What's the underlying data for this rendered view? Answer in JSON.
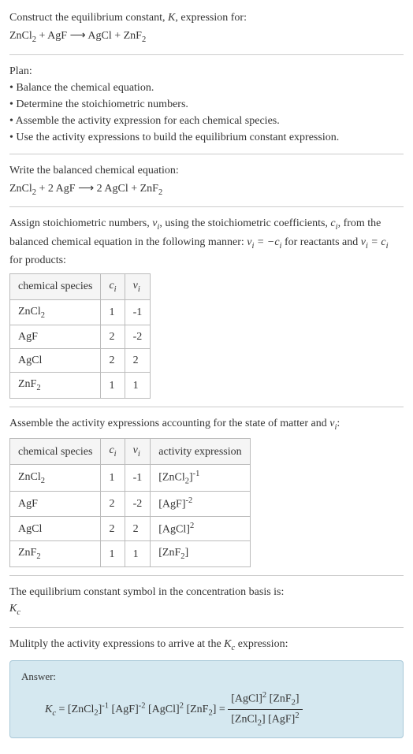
{
  "intro": {
    "line1": "Construct the equilibrium constant, ",
    "k": "K",
    "line1b": ", expression for:",
    "eq": "ZnCl₂ + AgF ⟶ AgCl + ZnF₂"
  },
  "plan": {
    "title": "Plan:",
    "items": [
      "• Balance the chemical equation.",
      "• Determine the stoichiometric numbers.",
      "• Assemble the activity expression for each chemical species.",
      "• Use the activity expressions to build the equilibrium constant expression."
    ]
  },
  "balanced": {
    "title": "Write the balanced chemical equation:",
    "eq": "ZnCl₂ + 2 AgF ⟶ 2 AgCl + ZnF₂"
  },
  "stoich": {
    "text1": "Assign stoichiometric numbers, ",
    "vi": "νᵢ",
    "text2": ", using the stoichiometric coefficients, ",
    "ci": "cᵢ",
    "text3": ", from the balanced chemical equation in the following manner: ",
    "rel1": "νᵢ = −cᵢ",
    "text4": " for reactants and ",
    "rel2": "νᵢ = cᵢ",
    "text5": " for products:",
    "headers": [
      "chemical species",
      "cᵢ",
      "νᵢ"
    ],
    "rows": [
      [
        "ZnCl₂",
        "1",
        "-1"
      ],
      [
        "AgF",
        "2",
        "-2"
      ],
      [
        "AgCl",
        "2",
        "2"
      ],
      [
        "ZnF₂",
        "1",
        "1"
      ]
    ]
  },
  "activity": {
    "text1": "Assemble the activity expressions accounting for the state of matter and ",
    "vi": "νᵢ",
    "text2": ":",
    "headers": [
      "chemical species",
      "cᵢ",
      "νᵢ",
      "activity expression"
    ],
    "rows": [
      {
        "species": "ZnCl₂",
        "c": "1",
        "v": "-1",
        "expr_base": "[ZnCl₂]",
        "expr_sup": "-1"
      },
      {
        "species": "AgF",
        "c": "2",
        "v": "-2",
        "expr_base": "[AgF]",
        "expr_sup": "-2"
      },
      {
        "species": "AgCl",
        "c": "2",
        "v": "2",
        "expr_base": "[AgCl]",
        "expr_sup": "2"
      },
      {
        "species": "ZnF₂",
        "c": "1",
        "v": "1",
        "expr_base": "[ZnF₂]",
        "expr_sup": ""
      }
    ]
  },
  "kcsymbol": {
    "line1": "The equilibrium constant symbol in the concentration basis is:",
    "kc": "K",
    "kcsub": "c"
  },
  "multiply": {
    "line1": "Mulitply the activity expressions to arrive at the ",
    "kc": "K",
    "kcsub": "c",
    "line2": " expression:"
  },
  "answer": {
    "label": "Answer:",
    "kc": "K",
    "kcsub": "c",
    "eq": " = [ZnCl₂]",
    "sup1": "-1",
    "t2": " [AgF]",
    "sup2": "-2",
    "t3": " [AgCl]",
    "sup3": "2",
    "t4": " [ZnF₂] = ",
    "num1": "[AgCl]",
    "numsup": "2",
    "num2": " [ZnF₂]",
    "den1": "[ZnCl₂] [AgF]",
    "densup": "2"
  }
}
